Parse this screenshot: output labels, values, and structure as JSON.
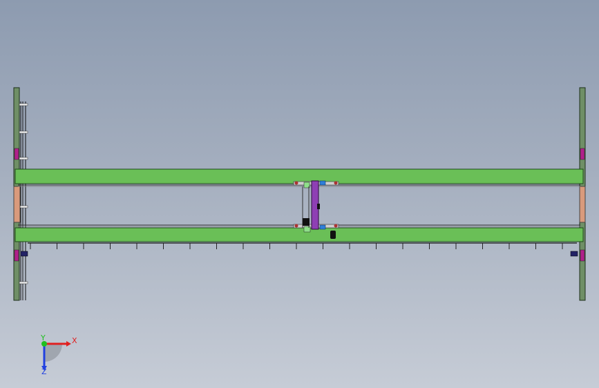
{
  "viewport": {
    "background_top": "#8d9bb0",
    "background_bottom": "#c6ccd6"
  },
  "colors": {
    "girder_fill": "#6abf57",
    "girder_edge": "#1e4a1a",
    "column_fill": "#6f8f66",
    "end_panel": "#d99a7c",
    "trolley_frame": "#8e3fb4",
    "trolley_blue": "#2f7ed8",
    "dark": "#111111",
    "magenta": "#b0208a",
    "light_green": "#8fe08a"
  },
  "triad": {
    "x_label": "X",
    "y_label": "Y",
    "z_label": "Z",
    "x_color": "#e02020",
    "y_color": "#20c020",
    "z_color": "#2040e0"
  }
}
